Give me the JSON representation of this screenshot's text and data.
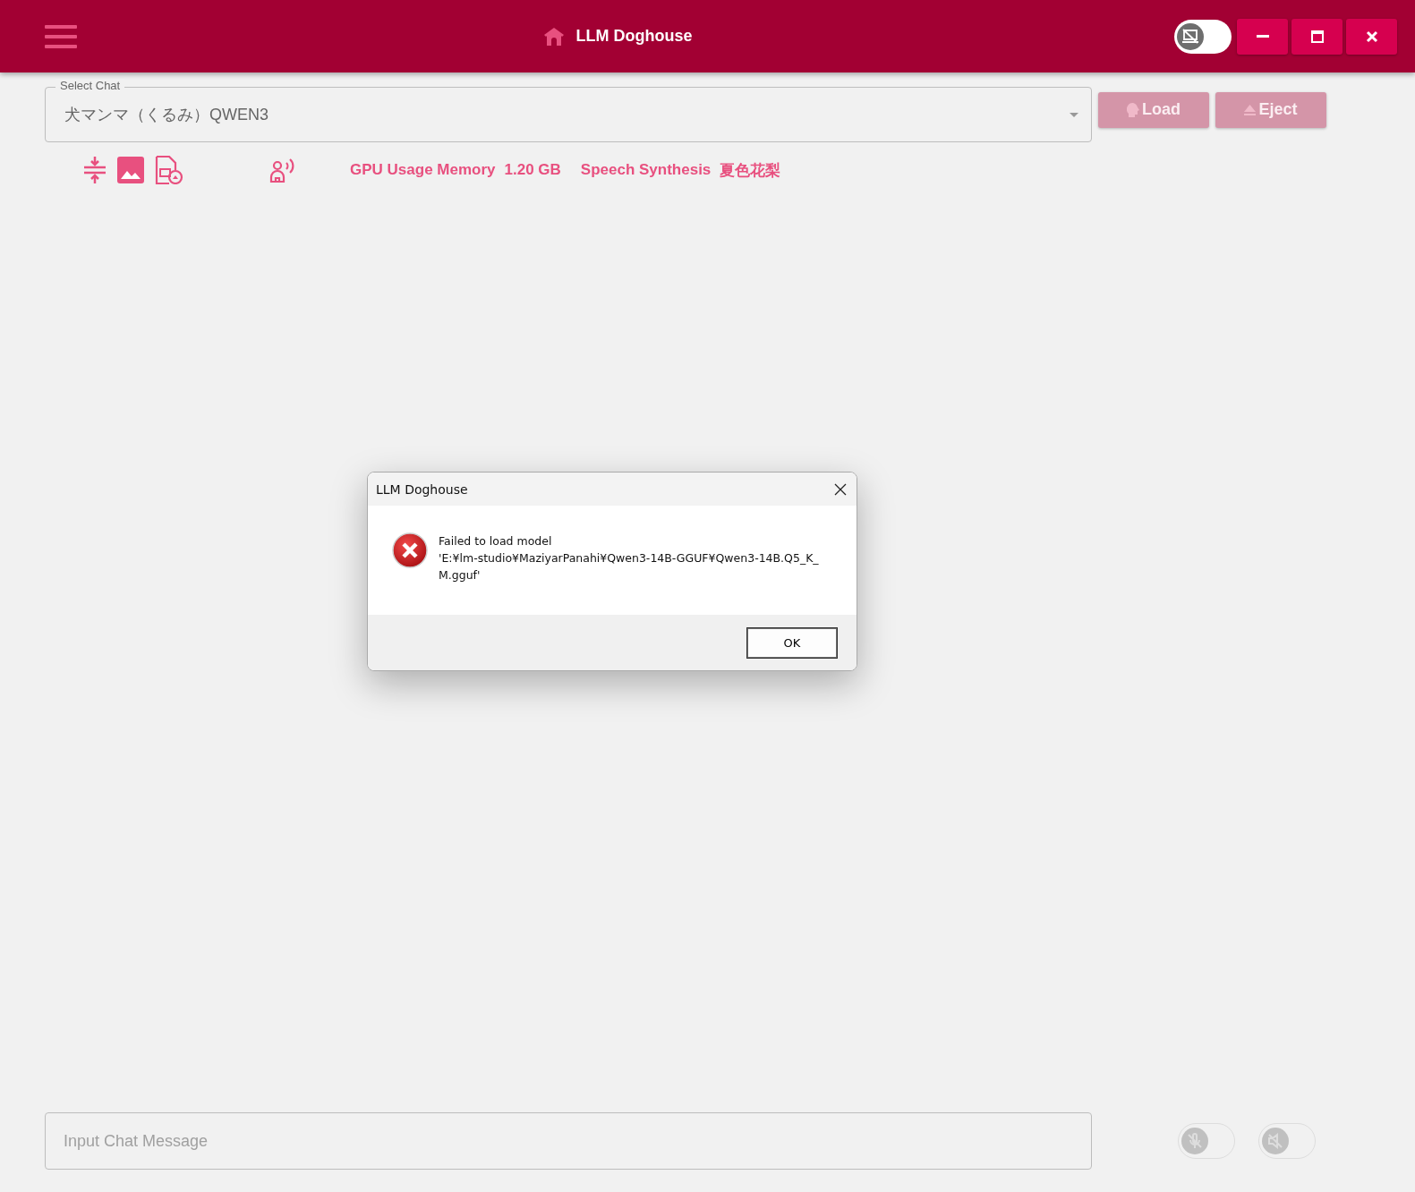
{
  "header": {
    "title": "LLM Doghouse",
    "display_toggle": {
      "on": false
    }
  },
  "chat_select": {
    "label": "Select Chat",
    "value": "犬マンマ（くるみ）QWEN3"
  },
  "buttons": [
    {
      "kind": "load",
      "label": "Load",
      "disabled": true
    },
    {
      "kind": "eject",
      "label": "Eject",
      "disabled": true
    }
  ],
  "status": [
    {
      "label": "GPU Usage Memory",
      "value": "1.20 GB"
    },
    {
      "label": "Speech Synthesis",
      "value": "夏色花梨"
    }
  ],
  "input": {
    "placeholder": "Input Chat Message"
  },
  "bottom_toggles": [
    {
      "kind": "mic",
      "on": false,
      "disabled": true
    },
    {
      "kind": "speaker",
      "on": false,
      "disabled": true
    }
  ],
  "dialog": {
    "title": "LLM Doghouse",
    "message_lines": [
      "Failed to load model",
      "'E:¥lm-studio¥MaziyarPanahi¥Qwen3-14B-GGUF¥Qwen3-14B.Q5_K_",
      "M.gguf'"
    ],
    "button": "OK"
  }
}
